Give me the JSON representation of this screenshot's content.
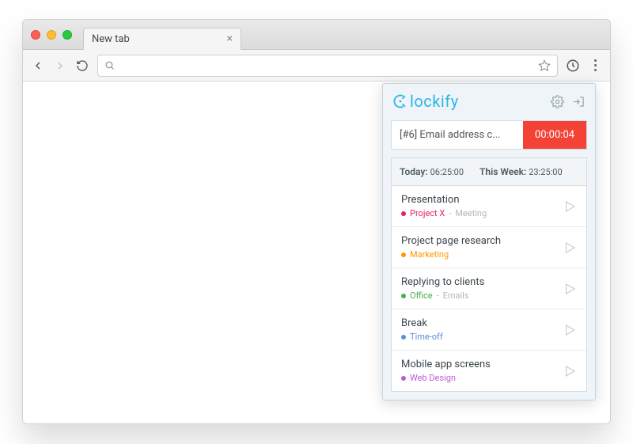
{
  "browser": {
    "tab_title": "New tab"
  },
  "popup": {
    "brand": "lockify",
    "timer": {
      "description": "[#6] Email address c...",
      "elapsed": "00:00:04"
    },
    "summary": {
      "today_label": "Today:",
      "today_value": "06:25:00",
      "week_label": "This Week:",
      "week_value": "23:25:00"
    },
    "entries": [
      {
        "title": "Presentation",
        "project": "Project X",
        "project_color": "#e91e63",
        "tag": "Meeting"
      },
      {
        "title": "Project page research",
        "project": "Marketing",
        "project_color": "#ff9800",
        "tag": ""
      },
      {
        "title": "Replying to clients",
        "project": "Office",
        "project_color": "#4caf50",
        "tag": "Emails"
      },
      {
        "title": "Break",
        "project": "Time-off",
        "project_color": "#5c8fd6",
        "tag": ""
      },
      {
        "title": "Mobile app screens",
        "project": "Web Design",
        "project_color": "#c158dc",
        "tag": ""
      }
    ]
  }
}
